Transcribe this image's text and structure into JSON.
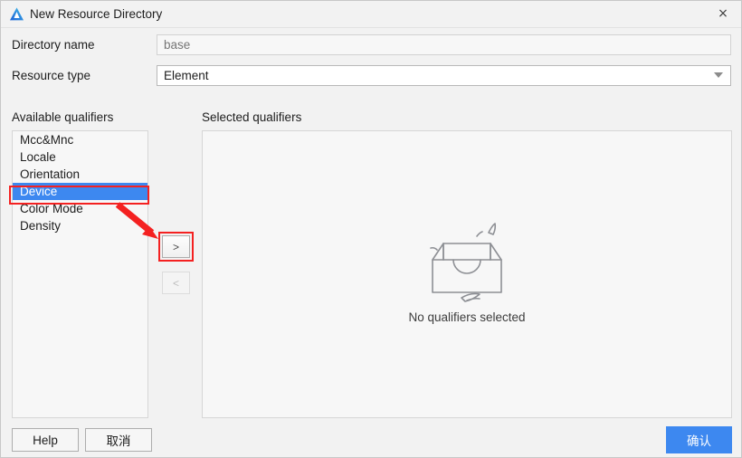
{
  "window": {
    "title": "New Resource Directory",
    "icon": "deveco-logo-icon",
    "close_label": "×"
  },
  "form": {
    "directory_name": {
      "label": "Directory name",
      "value": "",
      "placeholder": "base"
    },
    "resource_type": {
      "label": "Resource type",
      "value": "Element",
      "options": [
        "Element"
      ]
    }
  },
  "available": {
    "heading": "Available qualifiers",
    "items": [
      {
        "label": "Mcc&Mnc",
        "selected": false
      },
      {
        "label": "Locale",
        "selected": false
      },
      {
        "label": "Orientation",
        "selected": false
      },
      {
        "label": "Device",
        "selected": true
      },
      {
        "label": "Color Mode",
        "selected": false
      },
      {
        "label": "Density",
        "selected": false
      }
    ]
  },
  "transfer": {
    "move_right_label": ">",
    "move_left_label": "<"
  },
  "selected": {
    "heading": "Selected qualifiers",
    "empty_text": "No qualifiers selected",
    "empty_icon": "empty-box-icon"
  },
  "footer": {
    "help_label": "Help",
    "cancel_label": "取消",
    "confirm_label": "确认"
  },
  "annotations": {
    "highlight_color": "#f42121",
    "arrow_name": "red-arrow-annotation"
  },
  "colors": {
    "accent": "#3d88f0",
    "dialog_bg": "#f2f2f2",
    "panel_bg": "#f7f7f7",
    "annotation": "#f42121"
  }
}
